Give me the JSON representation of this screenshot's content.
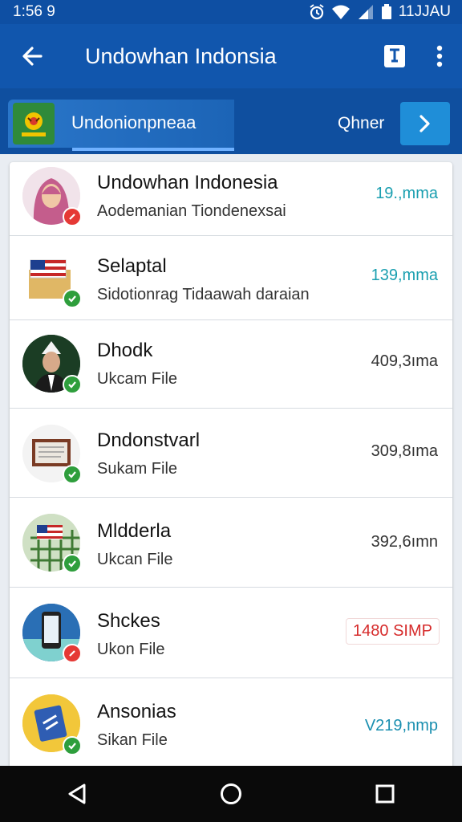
{
  "status_bar": {
    "time": "1:56 9",
    "carrier": "11JJAU"
  },
  "app_bar": {
    "title": "Undowhan Indonsia"
  },
  "tab_strip": {
    "label": "Undonionpneaa",
    "other": "Qhner"
  },
  "list": [
    {
      "title": "Undowhan Indonesia",
      "subtitle": "Aodemanian Tiondenexsai",
      "size": "19.,mma",
      "size_color": "#1a9fb0",
      "badge": "red",
      "avatar_icon": "woman-hijab-avatar"
    },
    {
      "title": "Selaptal",
      "subtitle": "Sidotionrag Tidaawah daraian",
      "size": "139,mma",
      "size_color": "#1a9fb0",
      "badge": "green",
      "avatar_icon": "flag-box-avatar"
    },
    {
      "title": "Dhodk",
      "subtitle": "Ukcam File",
      "size": "409,3ıma",
      "size_color": "#333333",
      "badge": "green",
      "avatar_icon": "man-portrait-avatar"
    },
    {
      "title": "Dndonstvarl",
      "subtitle": "Sukam File",
      "size": "309,8ıma",
      "size_color": "#333333",
      "badge": "green",
      "avatar_icon": "board-avatar"
    },
    {
      "title": "Mldderla",
      "subtitle": "Ukcan File",
      "size": "392,6ımn",
      "size_color": "#333333",
      "badge": "green",
      "avatar_icon": "flag-fence-avatar"
    },
    {
      "title": "Shckes",
      "subtitle": "Ukon File",
      "size": "1480 SIMP",
      "size_color": "#d62b2b",
      "badge": "red",
      "avatar_icon": "phone-avatar"
    },
    {
      "title": "Ansonias",
      "subtitle": "Sikan File",
      "size": "V219,nmp",
      "size_color": "#1a8fb0",
      "badge": "green",
      "avatar_icon": "card-avatar"
    }
  ],
  "colors": {
    "primary": "#1156ad",
    "accent": "#1f8ed8",
    "badge_red": "#e53935",
    "badge_green": "#2e9e3c"
  }
}
